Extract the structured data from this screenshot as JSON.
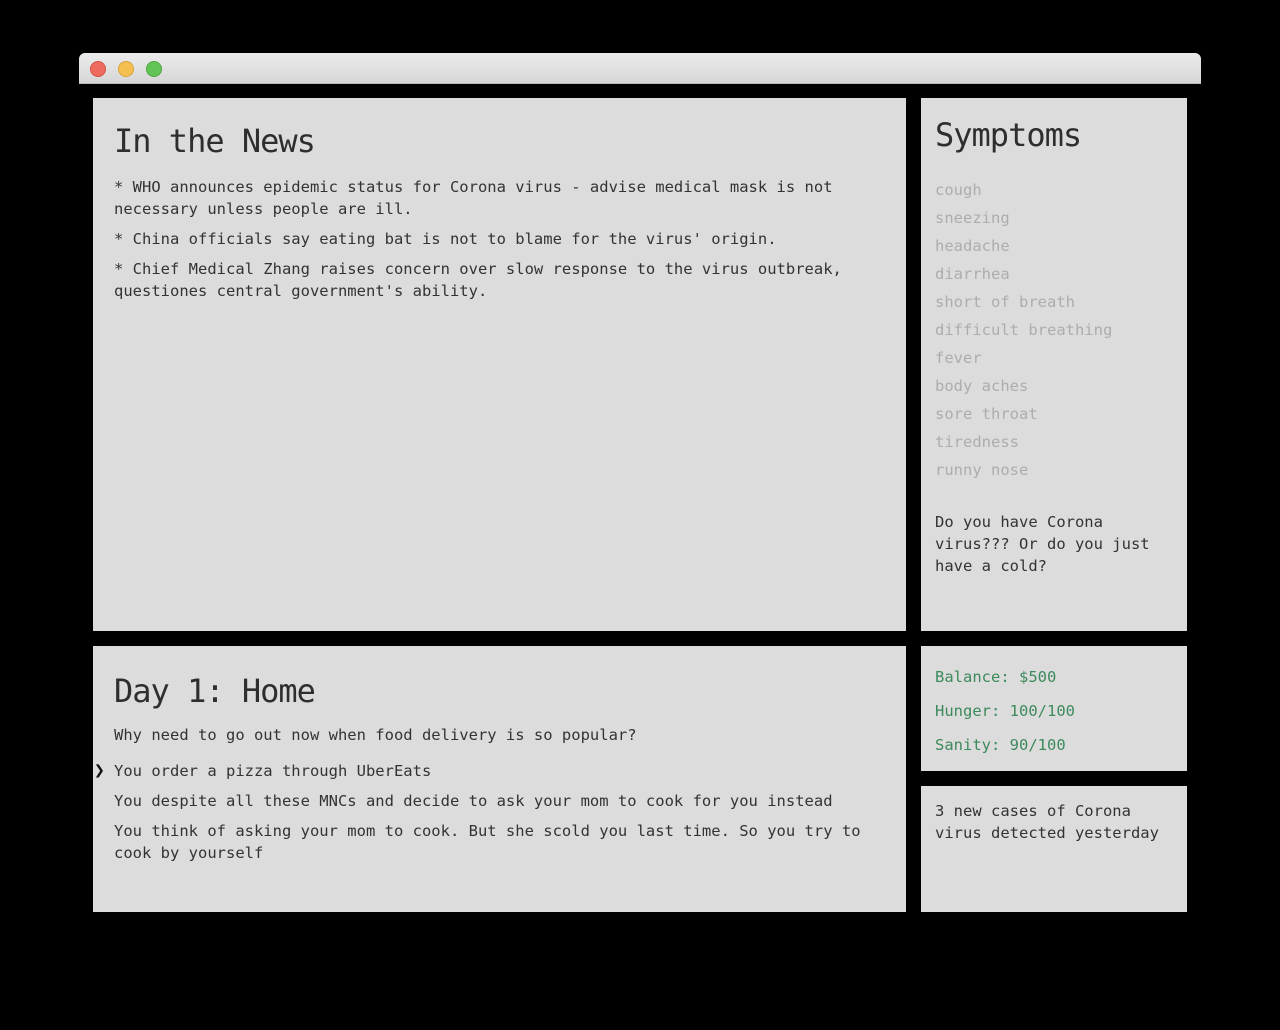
{
  "news": {
    "title": "In the News",
    "items": [
      "* WHO announces epidemic status for Corona virus - advise medical mask is not necessary unless people are ill.",
      "* China officials say eating bat is not to blame for the virus' origin.",
      "* Chief Medical Zhang raises concern over slow response to the virus outbreak, questiones central government's ability."
    ]
  },
  "symptoms": {
    "title": "Symptoms",
    "items": [
      "cough",
      "sneezing",
      "headache",
      "diarrhea",
      "short of breath",
      "difficult breathing",
      "fever",
      "body aches",
      "sore throat",
      "tiredness",
      "runny nose"
    ],
    "question": "Do you have Corona virus??? Or do you just have a cold?",
    "item_color": "#adadad"
  },
  "day": {
    "title": "Day 1:  Home",
    "description": "Why need to go out now when food delivery is so popular?",
    "cursor": "❯",
    "choices": [
      "You order a pizza through UberEats",
      "You despite all these MNCs and decide to ask your mom to cook for you instead",
      "You think of asking your mom to cook. But she scold you last time. So you try to cook by yourself"
    ]
  },
  "stats": {
    "balance": "Balance: $500",
    "hunger": "Hunger: 100/100",
    "sanity": "Sanity: 90/100",
    "color": "#3d8a5c"
  },
  "alert": {
    "text": "3 new cases of Corona virus detected yesterday"
  }
}
